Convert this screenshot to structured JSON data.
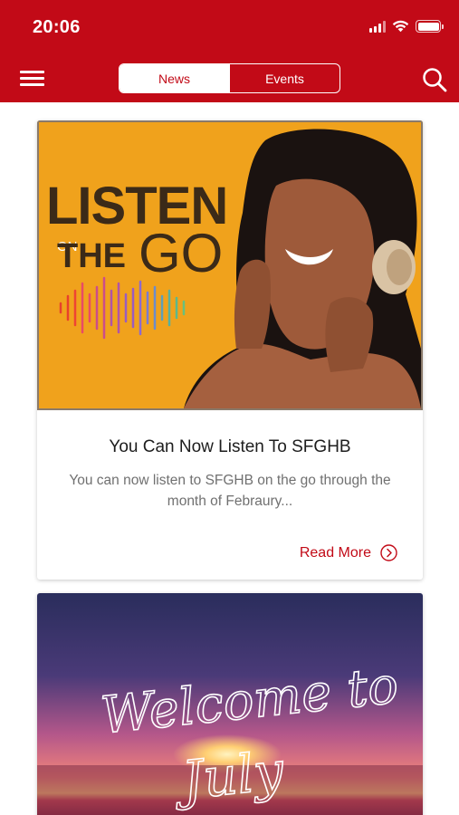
{
  "status_bar": {
    "time": "20:06"
  },
  "nav": {
    "tabs": [
      {
        "label": "News",
        "active": true
      },
      {
        "label": "Events",
        "active": false
      }
    ]
  },
  "cards": [
    {
      "image_text": {
        "line1": "LISTEN",
        "small": "ON",
        "line2a": "THE",
        "line2b": "GO"
      },
      "title": "You Can Now Listen To SFGHB",
      "description": "You can now listen to SFGHB on the go through the month of Febraury...",
      "read_more": "Read More"
    },
    {
      "image_text": {
        "line1": "Welcome to",
        "line2": "July"
      }
    }
  ],
  "colors": {
    "brand_red": "#c20a17",
    "card1_bg": "#f0a21c"
  },
  "icons": [
    "menu-icon",
    "search-icon",
    "chevron-right-circle-icon",
    "wifi-icon",
    "battery-icon",
    "signal-icon"
  ]
}
